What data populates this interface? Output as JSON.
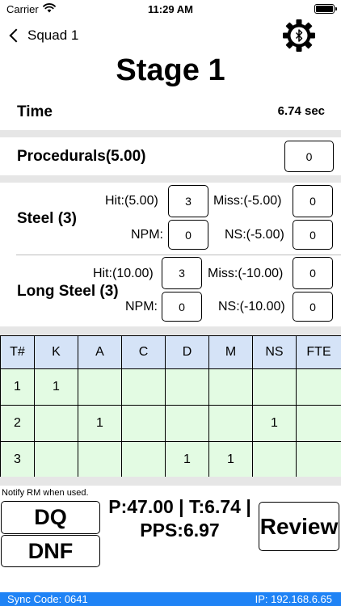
{
  "status_bar": {
    "carrier": "Carrier",
    "time": "11:29 AM"
  },
  "nav": {
    "back_label": "Squad 1"
  },
  "stage": {
    "title": "Stage 1"
  },
  "time_row": {
    "label": "Time",
    "value": "6.74 sec"
  },
  "procedurals": {
    "label": "Procedurals(5.00)",
    "value": "0"
  },
  "steel": {
    "label": "Steel (3)",
    "hit_label": "Hit:(5.00)",
    "hit_value": "3",
    "miss_label": "Miss:(-5.00)",
    "miss_value": "0",
    "npm_label": "NPM:",
    "npm_value": "0",
    "ns_label": "NS:(-5.00)",
    "ns_value": "0"
  },
  "long_steel": {
    "label": "Long Steel (3)",
    "hit_label": "Hit:(10.00)",
    "hit_value": "3",
    "miss_label": "Miss:(-10.00)",
    "miss_value": "0",
    "npm_label": "NPM:",
    "npm_value": "0",
    "ns_label": "NS:(-10.00)",
    "ns_value": "0"
  },
  "score_table": {
    "headers": [
      "T#",
      "K",
      "A",
      "C",
      "D",
      "M",
      "NS",
      "FTE"
    ],
    "rows": [
      [
        "1",
        "1",
        "",
        "",
        "",
        "",
        "",
        ""
      ],
      [
        "2",
        "",
        "1",
        "",
        "",
        "",
        "1",
        ""
      ],
      [
        "3",
        "",
        "",
        "",
        "1",
        "1",
        "",
        ""
      ]
    ]
  },
  "footer_actions": {
    "notify": "Notify RM when used.",
    "dq_label": "DQ",
    "dnf_label": "DNF",
    "review_label": "Review",
    "summary_line1": "P:47.00 | T:6.74 |",
    "summary_line2": "PPS:6.97"
  },
  "footer": {
    "sync_code": "Sync Code: 0641",
    "ip": "IP: 192.168.6.65"
  },
  "colors": {
    "header_blue": "#d5e3f7",
    "cell_green": "#e3fbe3",
    "footer_blue": "#1f83f5",
    "separator_gray": "#e6e6e6"
  },
  "icons": {
    "back": "chevron-left-icon",
    "settings": "bluetooth-gear-icon",
    "wifi": "wifi-icon",
    "battery": "battery-icon"
  }
}
